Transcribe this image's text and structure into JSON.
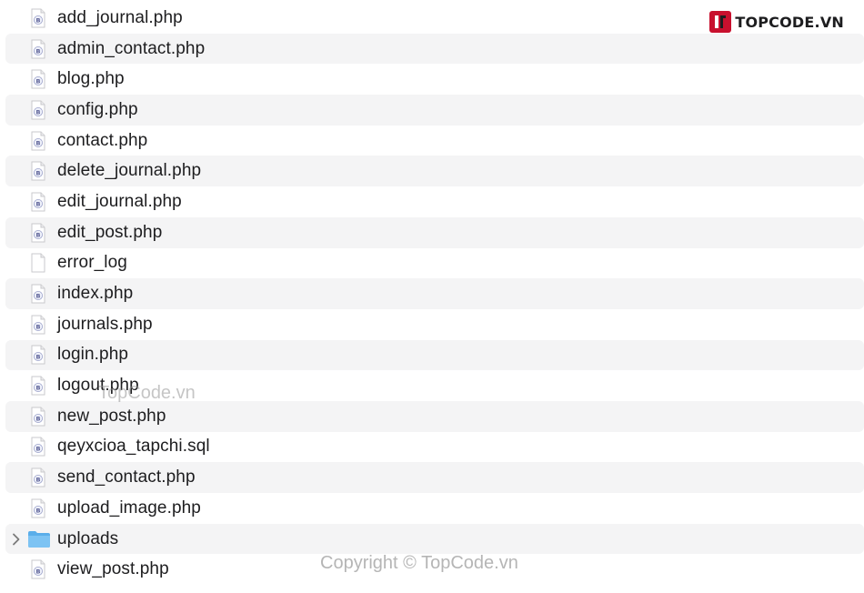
{
  "brand": {
    "logo_text": "TOPCODE.VN",
    "logo_color": "#c8102e"
  },
  "files": [
    {
      "name": "add_journal.php",
      "type": "php"
    },
    {
      "name": "admin_contact.php",
      "type": "php"
    },
    {
      "name": "blog.php",
      "type": "php"
    },
    {
      "name": "config.php",
      "type": "php"
    },
    {
      "name": "contact.php",
      "type": "php"
    },
    {
      "name": "delete_journal.php",
      "type": "php"
    },
    {
      "name": "edit_journal.php",
      "type": "php"
    },
    {
      "name": "edit_post.php",
      "type": "php"
    },
    {
      "name": "error_log",
      "type": "generic"
    },
    {
      "name": "index.php",
      "type": "php"
    },
    {
      "name": "journals.php",
      "type": "php"
    },
    {
      "name": "login.php",
      "type": "php"
    },
    {
      "name": "logout.php",
      "type": "php"
    },
    {
      "name": "new_post.php",
      "type": "php"
    },
    {
      "name": "qeyxcioa_tapchi.sql",
      "type": "sql"
    },
    {
      "name": "send_contact.php",
      "type": "php"
    },
    {
      "name": "upload_image.php",
      "type": "php"
    },
    {
      "name": "uploads",
      "type": "folder"
    },
    {
      "name": "view_post.php",
      "type": "php"
    }
  ],
  "watermarks": {
    "middle": "TopCode.vn",
    "bottom": "Copyright © TopCode.vn"
  },
  "colors": {
    "row_alt": "#f4f4f5",
    "folder": "#5aaeea",
    "text": "#1d1d1f"
  }
}
